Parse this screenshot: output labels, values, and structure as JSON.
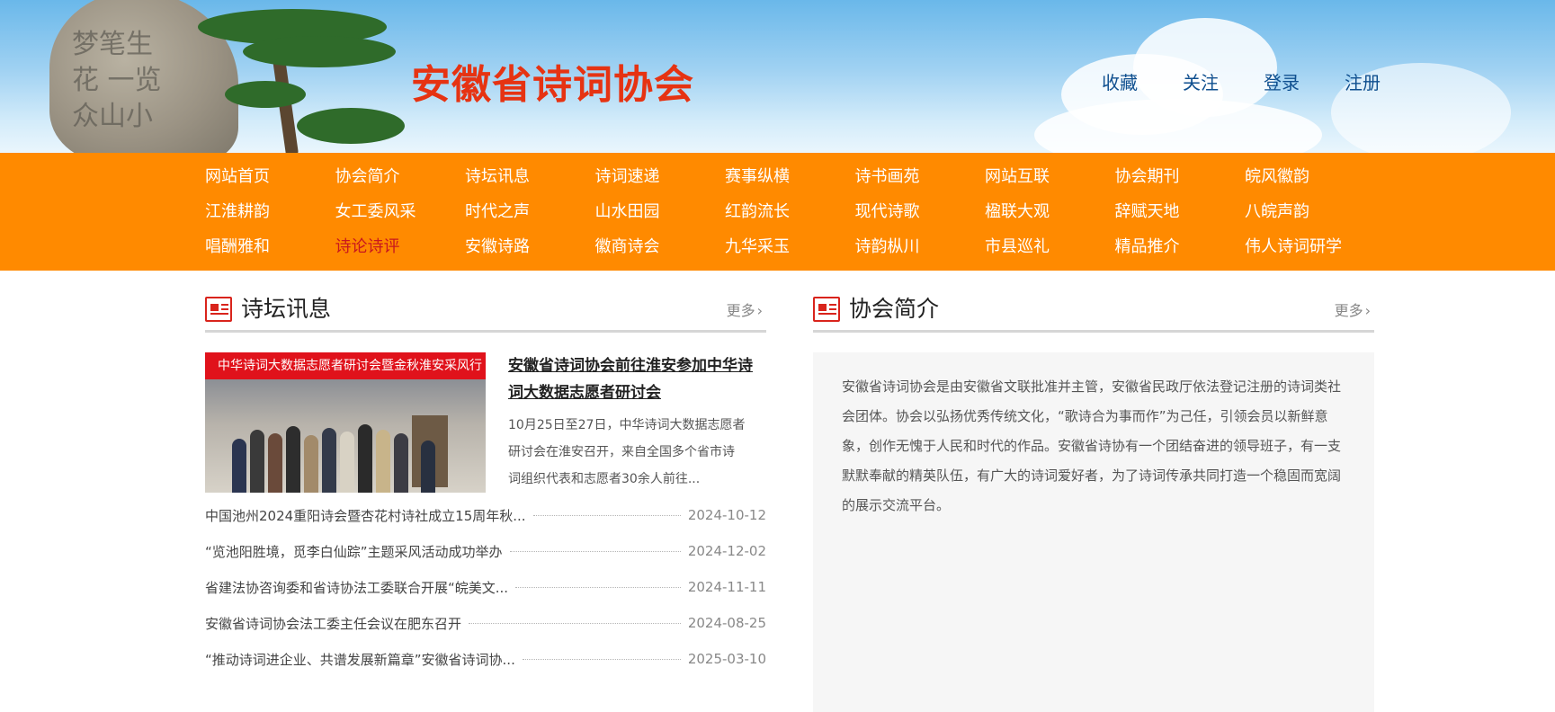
{
  "header": {
    "site_title": "安徽省诗词协会",
    "rock_calligraphy": "梦笔生花 一览众山小",
    "top_links": [
      "收藏",
      "关注",
      "登录",
      "注册"
    ]
  },
  "nav": {
    "items": [
      "网站首页",
      "协会简介",
      "诗坛讯息",
      "诗词速递",
      "赛事纵横",
      "诗书画苑",
      "网站互联",
      "协会期刊",
      "皖风徽韵",
      "江淮耕韵",
      "女工委风采",
      "时代之声",
      "山水田园",
      "红韵流长",
      "现代诗歌",
      "楹联大观",
      "辞赋天地",
      "八皖声韵",
      "唱酬雅和",
      "诗论诗评",
      "安徽诗路",
      "徽商诗会",
      "九华采玉",
      "诗韵枞川",
      "市县巡礼",
      "精品推介",
      "伟人诗词研学"
    ],
    "active_item": "诗论诗评"
  },
  "news_section": {
    "title": "诗坛讯息",
    "more_label": "更多",
    "featured": {
      "image_banner": "中华诗词大数据志愿者研讨会暨金秋淮安采风行",
      "title": "安徽省诗词协会前往淮安参加中华诗词大数据志愿者研讨会",
      "summary": "10月25日至27日，中华诗词大数据志愿者研讨会在淮安召开，来自全国多个省市诗词组织代表和志愿者30余人前往..."
    },
    "items": [
      {
        "title": "中国池州2024重阳诗会暨杏花村诗社成立15周年秋...",
        "date": "2024-10-12"
      },
      {
        "title": "“览池阳胜境，觅李白仙踪”主题采风活动成功举办",
        "date": "2024-12-02"
      },
      {
        "title": "省建法协咨询委和省诗协法工委联合开展“皖美文...",
        "date": "2024-11-11"
      },
      {
        "title": "安徽省诗词协会法工委主任会议在肥东召开",
        "date": "2024-08-25"
      },
      {
        "title": "“推动诗词进企业、共谱发展新篇章”安徽省诗词协...",
        "date": "2025-03-10"
      }
    ]
  },
  "intro_section": {
    "title": "协会简介",
    "more_label": "更多",
    "text": "安徽省诗词协会是由安徽省文联批准并主管，安徽省民政厅依法登记注册的诗词类社会团体。协会以弘扬优秀传统文化，“歌诗合为事而作”为己任，引领会员以新鲜意象，创作无愧于人民和时代的作品。安徽省诗协有一个团结奋进的领导班子，有一支默默奉献的精英队伍，有广大的诗词爱好者，为了诗词传承共同打造一个稳固而宽阔的展示交流平台。"
  },
  "colors": {
    "nav_bg": "#ff8a00",
    "title_red": "#e63312",
    "active_nav": "#c8171e",
    "link_blue": "#0f4f8f"
  },
  "icons": [
    "newspaper-icon",
    "chevron-right-icon"
  ]
}
